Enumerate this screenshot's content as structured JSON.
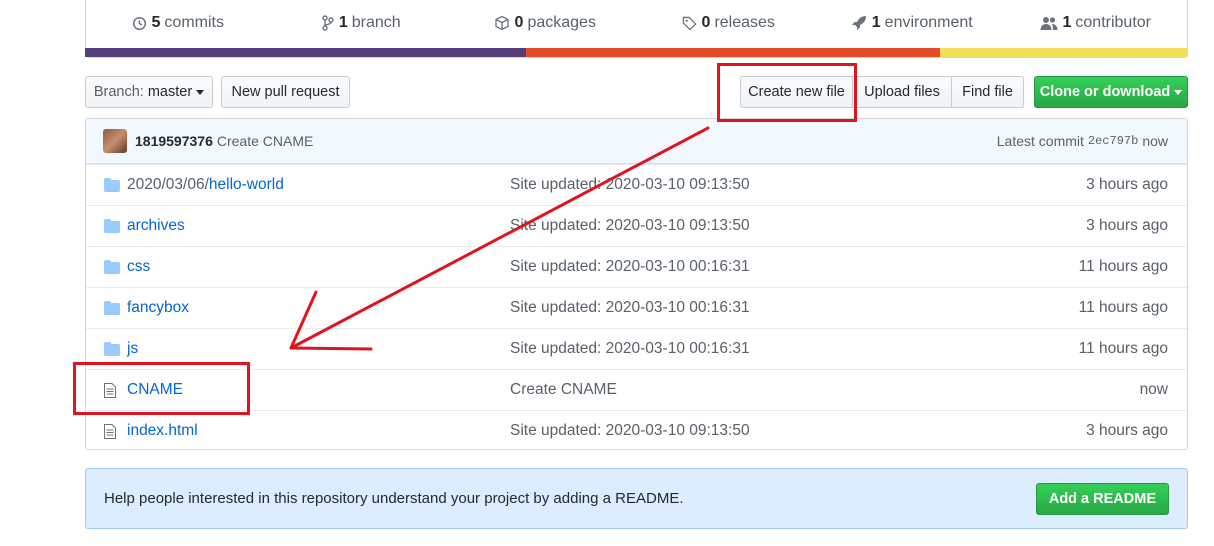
{
  "summary": {
    "items": [
      {
        "icon": "history-icon",
        "count": "5",
        "label": "commits"
      },
      {
        "icon": "git-branch-icon",
        "count": "1",
        "label": "branch"
      },
      {
        "icon": "package-icon",
        "count": "0",
        "label": "packages"
      },
      {
        "icon": "tag-icon",
        "count": "0",
        "label": "releases"
      },
      {
        "icon": "rocket-icon",
        "count": "1",
        "label": "environment"
      },
      {
        "icon": "people-icon",
        "count": "1",
        "label": "contributor"
      }
    ],
    "language_colors": [
      "#563d7c",
      "#e34c26",
      "#f1e05a"
    ]
  },
  "toolbar": {
    "branch_prefix": "Branch:",
    "branch_name": "master",
    "new_pull_request": "New pull request",
    "create_new_file": "Create new file",
    "upload_files": "Upload files",
    "find_file": "Find file",
    "clone_or_download": "Clone or download"
  },
  "latest_commit": {
    "author": "1819597376",
    "message": "Create CNAME",
    "label": "Latest commit",
    "sha": "2ec797b",
    "time": "now"
  },
  "files": [
    {
      "type": "directory",
      "dir_prefix": "2020/03/06/",
      "name": "hello-world",
      "message": "Site updated: 2020-03-10 09:13:50",
      "age": "3 hours ago"
    },
    {
      "type": "directory",
      "dir_prefix": "",
      "name": "archives",
      "message": "Site updated: 2020-03-10 09:13:50",
      "age": "3 hours ago"
    },
    {
      "type": "directory",
      "dir_prefix": "",
      "name": "css",
      "message": "Site updated: 2020-03-10 00:16:31",
      "age": "11 hours ago"
    },
    {
      "type": "directory",
      "dir_prefix": "",
      "name": "fancybox",
      "message": "Site updated: 2020-03-10 00:16:31",
      "age": "11 hours ago"
    },
    {
      "type": "directory",
      "dir_prefix": "",
      "name": "js",
      "message": "Site updated: 2020-03-10 00:16:31",
      "age": "11 hours ago"
    },
    {
      "type": "file",
      "dir_prefix": "",
      "name": "CNAME",
      "message": "Create CNAME",
      "age": "now"
    },
    {
      "type": "file",
      "dir_prefix": "",
      "name": "index.html",
      "message": "Site updated: 2020-03-10 09:13:50",
      "age": "3 hours ago"
    }
  ],
  "readme_prompt": {
    "text": "Help people interested in this repository understand your project by adding a README.",
    "button": "Add a README"
  },
  "annotation_color": "#e0141e"
}
